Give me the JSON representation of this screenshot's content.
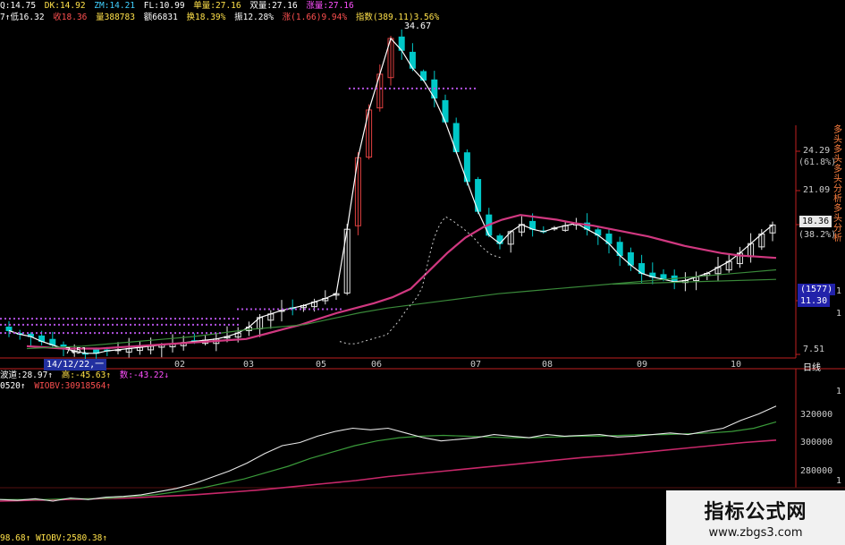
{
  "header": {
    "line1": [
      "Q:14.75",
      "DK:14.92",
      "ZM:14.21",
      "FL:10.99",
      "单量:27.16",
      "双量:27.16",
      "涨量:27.16"
    ],
    "line2": [
      "7↑低16.32",
      "收18.36",
      "量388783",
      "额66831",
      "换18.39%",
      "振12.28%",
      "涨(1.66)9.94%",
      "指数(389.11)3.56%"
    ]
  },
  "price_axis": {
    "labels": [
      "24.29",
      "(61.8%)",
      "21.09",
      "18.36",
      "(38.2%)",
      "(1577)",
      "11.30",
      "7.51"
    ],
    "current": "18.36"
  },
  "annotations": {
    "high": "34.67",
    "low": "7.51",
    "cursor_date": "14/12/22,一",
    "period": "日线",
    "vertical_side_text": "多头 多头 多头 分析 多头 分析"
  },
  "x_axis": {
    "labels": [
      "02",
      "03",
      "05",
      "06",
      "07",
      "08",
      "09",
      "10"
    ]
  },
  "indicator1": {
    "line": [
      "波道:28.97↑",
      "高:-45.63↑",
      "数:-43.22↓"
    ]
  },
  "indicator2": {
    "line": [
      "0520↑",
      "WIOBV:30918564↑"
    ],
    "axis": [
      "1",
      "320000",
      "300000",
      "280000",
      "1"
    ],
    "footer": "98.68↑  WIOBV:2580.38↑"
  },
  "watermark": {
    "title": "指标公式网",
    "url": "www.zbgs3.com"
  },
  "colors": {
    "up": "#e8e8e8",
    "down": "#00c8c8",
    "red_candle": "#e04040",
    "ma_magenta": "#d03880",
    "ma_green": "#3a8a3a",
    "ma_white": "#dddddd",
    "marker": "#b050e0",
    "axis": "#c02020"
  },
  "chart_data": [
    {
      "type": "candlestick",
      "title": "",
      "ylim": [
        7.51,
        34.67
      ],
      "yticks": [
        24.29,
        21.09,
        18.36,
        11.3,
        7.51
      ],
      "x_labels": [
        "14/12/22",
        "02",
        "03",
        "05",
        "06",
        "07",
        "08",
        "09",
        "10"
      ],
      "high": 34.67,
      "low": 7.51,
      "last_close": 18.36,
      "series": [
        {
          "name": "",
          "values": [
            9.5,
            9.2,
            9.0,
            8.6,
            8.3,
            8.0,
            7.8,
            7.6,
            7.6,
            7.8,
            7.9,
            8.0,
            8.1,
            8.2,
            8.3,
            8.4,
            8.5,
            8.6,
            8.7,
            8.8,
            9.0,
            9.3,
            9.8,
            10.6,
            10.9,
            11.2,
            11.4,
            11.6,
            11.9,
            12.2,
            12.6,
            18.0,
            24.0,
            28.0,
            31.0,
            34.0,
            33.0,
            31.5,
            30.5,
            29.0,
            27.0,
            24.5,
            22.0,
            19.5,
            17.5,
            16.8,
            17.8,
            18.4,
            18.0,
            17.8,
            18.1,
            18.3,
            18.5,
            18.0,
            17.5,
            16.8,
            15.8,
            15.0,
            14.3,
            14.0,
            13.8,
            13.6,
            13.7,
            14.0,
            14.3,
            14.8,
            15.3,
            16.0,
            16.8,
            17.6,
            18.36
          ]
        },
        {
          "name": "",
          "values": [
            8.2,
            8.1,
            8.0,
            8.0,
            8.0,
            8.1,
            8.2,
            8.3,
            8.4,
            8.5,
            8.6,
            8.7,
            8.8,
            9.2,
            9.6,
            10.0,
            10.5,
            11.0,
            11.4,
            11.8,
            12.3,
            13.0,
            14.5,
            16.0,
            17.3,
            18.2,
            18.8,
            19.2,
            19.0,
            18.8,
            18.5,
            18.3,
            18.0,
            17.7,
            17.4,
            17.0,
            16.6,
            16.3,
            16.0,
            15.8,
            15.7,
            15.6
          ]
        },
        {
          "name": "",
          "values": [
            8.0,
            8.1,
            8.2,
            8.4,
            8.6,
            8.8,
            9.0,
            9.3,
            9.6,
            9.8,
            10.0,
            10.5,
            11.0,
            11.4,
            11.7,
            12.0,
            12.3,
            12.6,
            12.8,
            13.0,
            13.2,
            13.4,
            13.6,
            13.8,
            14.0,
            14.2,
            14.4,
            14.6
          ]
        }
      ]
    },
    {
      "type": "line",
      "title": "",
      "ylabel": "",
      "ylim": [
        270000,
        340000
      ],
      "yticks": [
        320000,
        300000,
        280000
      ],
      "series": [
        {
          "name": "",
          "values": [
            271000,
            270500,
            271500,
            270000,
            272000,
            271000,
            272500,
            273000,
            274000,
            276000,
            278000,
            281000,
            285000,
            289000,
            294000,
            300000,
            305000,
            307000,
            311000,
            314000,
            316000,
            315000,
            316000,
            313000,
            310000,
            308000,
            309000,
            310000,
            312000,
            311000,
            310000,
            312000,
            311000,
            311500,
            312000,
            310500,
            311000,
            312000,
            313000,
            312000,
            314000,
            316000,
            321000,
            325000,
            330000
          ]
        },
        {
          "name": "",
          "values": [
            271000,
            271000,
            271000,
            271500,
            271500,
            272000,
            273000,
            274000,
            276000,
            278000,
            281000,
            284000,
            288000,
            292000,
            297000,
            301000,
            305000,
            308000,
            310000,
            311000,
            311500,
            311000,
            310500,
            310000,
            310000,
            310500,
            311000,
            311000,
            311500,
            312000,
            312000,
            312500,
            313000,
            314000,
            316000,
            320000
          ]
        },
        {
          "name": "",
          "values": [
            270000,
            270500,
            271000,
            271500,
            272000,
            273000,
            274000,
            275500,
            277000,
            279000,
            281000,
            283000,
            285500,
            287500,
            289500,
            291500,
            293500,
            295500,
            297500,
            299000,
            301000,
            303000,
            305000,
            307000,
            308500
          ]
        }
      ]
    }
  ]
}
